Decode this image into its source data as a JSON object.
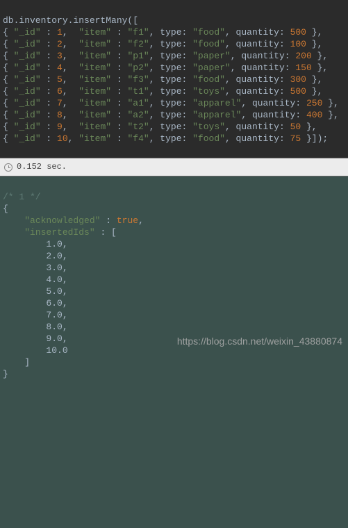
{
  "code": {
    "call": "db.inventory.insertMany([",
    "rows": [
      {
        "_id": 1,
        "item": "f1",
        "type": "food",
        "quantity": 500
      },
      {
        "_id": 2,
        "item": "f2",
        "type": "food",
        "quantity": 100
      },
      {
        "_id": 3,
        "item": "p1",
        "type": "paper",
        "quantity": 200
      },
      {
        "_id": 4,
        "item": "p2",
        "type": "paper",
        "quantity": 150
      },
      {
        "_id": 5,
        "item": "f3",
        "type": "food",
        "quantity": 300
      },
      {
        "_id": 6,
        "item": "t1",
        "type": "toys",
        "quantity": 500
      },
      {
        "_id": 7,
        "item": "a1",
        "type": "apparel",
        "quantity": 250
      },
      {
        "_id": 8,
        "item": "a2",
        "type": "apparel",
        "quantity": 400
      },
      {
        "_id": 9,
        "item": "t2",
        "type": "toys",
        "quantity": 50
      },
      {
        "_id": 10,
        "item": "f4",
        "type": "food",
        "quantity": 75
      }
    ],
    "close": "]);"
  },
  "key_labels": {
    "id": "\"_id\"",
    "item": "\"item\"",
    "type_field": "type",
    "quantity_field": "quantity"
  },
  "timing": {
    "text": "0.152 sec."
  },
  "result": {
    "comment": "/* 1 */",
    "acknowledged_key": "\"acknowledged\"",
    "acknowledged_val": "true",
    "insertedIds_key": "\"insertedIds\"",
    "ids": [
      "1.0",
      "2.0",
      "3.0",
      "4.0",
      "5.0",
      "6.0",
      "7.0",
      "8.0",
      "9.0",
      "10.0"
    ]
  },
  "watermark": "https://blog.csdn.net/weixin_43880874"
}
